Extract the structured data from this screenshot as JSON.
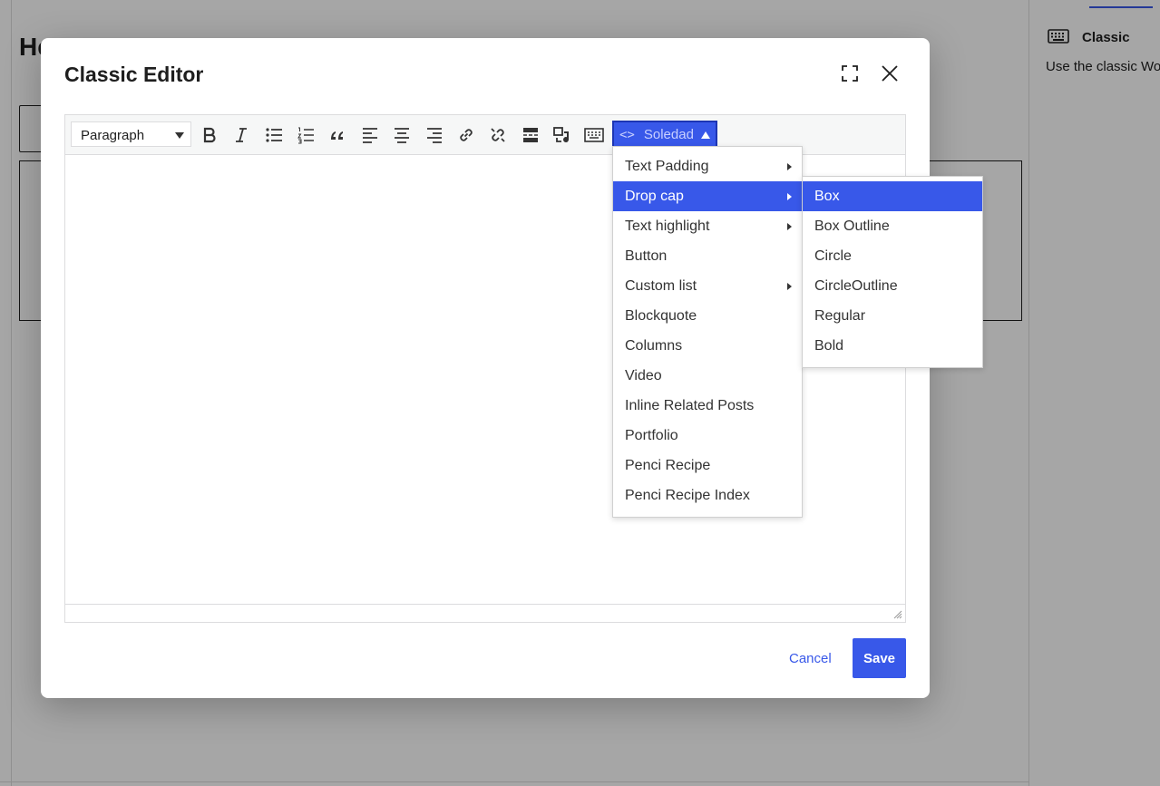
{
  "background": {
    "heading": "He",
    "sidebar": {
      "block_title": "Classic",
      "block_description": "Use the classic Wo",
      "icon": "keyboard-icon"
    }
  },
  "modal": {
    "title": "Classic Editor",
    "fullscreen_icon": "fullscreen-icon",
    "close_icon": "close-icon",
    "toolbar": {
      "format_value": "Paragraph",
      "buttons": [
        "bold-icon",
        "italic-icon",
        "bulleted-list-icon",
        "numbered-list-icon",
        "blockquote-icon",
        "align-left-icon",
        "align-center-icon",
        "align-right-icon",
        "link-icon",
        "unlink-icon",
        "read-more-icon",
        "insert-media-icon",
        "toolbar-toggle-icon"
      ],
      "shortcode_button": {
        "icon": "code-icon",
        "label": "Soledad"
      }
    },
    "cancel_label": "Cancel",
    "save_label": "Save"
  },
  "dropdown": {
    "items": [
      {
        "label": "Text Padding",
        "has_submenu": true
      },
      {
        "label": "Drop cap",
        "has_submenu": true,
        "active": true
      },
      {
        "label": "Text highlight",
        "has_submenu": true
      },
      {
        "label": "Button",
        "has_submenu": false
      },
      {
        "label": "Custom list",
        "has_submenu": true
      },
      {
        "label": "Blockquote",
        "has_submenu": false
      },
      {
        "label": "Columns",
        "has_submenu": false
      },
      {
        "label": "Video",
        "has_submenu": false
      },
      {
        "label": "Inline Related Posts",
        "has_submenu": false
      },
      {
        "label": "Portfolio",
        "has_submenu": false
      },
      {
        "label": "Penci Recipe",
        "has_submenu": false
      },
      {
        "label": "Penci Recipe Index",
        "has_submenu": false
      }
    ],
    "submenu": {
      "items": [
        {
          "label": "Box",
          "active": true
        },
        {
          "label": "Box Outline"
        },
        {
          "label": "Circle"
        },
        {
          "label": "CircleOutline"
        },
        {
          "label": "Regular"
        },
        {
          "label": "Bold"
        }
      ]
    }
  },
  "colors": {
    "accent": "#3858e9",
    "overlay": "rgba(0,0,0,0.35)"
  }
}
